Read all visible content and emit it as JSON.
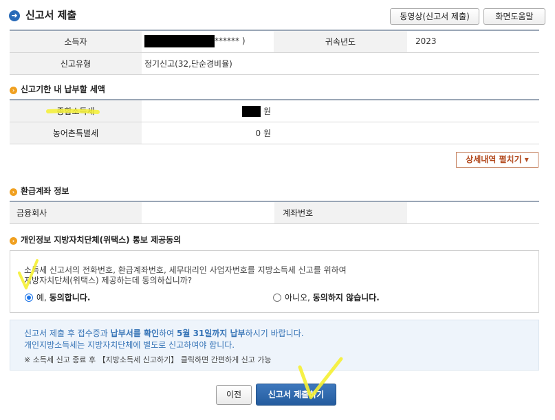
{
  "header": {
    "title": "신고서 제출",
    "video_button": "동영상(신고서 제출)",
    "help_button": "화면도움말"
  },
  "summary": {
    "taxpayer_label": "소득자",
    "taxpayer_value_suffix": "******  )",
    "year_label": "귀속년도",
    "year_value": "2023",
    "report_type_label": "신고유형",
    "report_type_value": "정기신고(32,단순경비율)"
  },
  "tax_section": {
    "title": "신고기한 내 납부할 세액",
    "rows": [
      {
        "label": "종합소득세",
        "amount": "",
        "unit": "원"
      },
      {
        "label": "농어촌특별세",
        "amount": "0",
        "unit": "원"
      }
    ],
    "detail_button": "상세내역 펼치기 ▾"
  },
  "refund_section": {
    "title": "환급계좌 정보",
    "bank_label": "금융회사",
    "bank_value": "",
    "account_label": "계좌번호",
    "account_value": ""
  },
  "consent_section": {
    "title": "개인정보 지방자치단체(위택스) 통보 제공동의",
    "text_line1": "소득세 신고서의 전화번호, 환급계좌번호, 세무대리인 사업자번호를 지방소득세 신고를 위하여",
    "text_line2": "지방자치단체(위택스) 제공하는데 동의하십니까?",
    "option_yes_prefix": "예, ",
    "option_yes_bold": "동의합니다.",
    "option_no_prefix": "아니오, ",
    "option_no_bold": "동의하지 않습니다.",
    "selected": "yes"
  },
  "notice": {
    "l1_a": "신고서 제출 후 접수증과 ",
    "l1_b": "납부서를 확인",
    "l1_c": "하여 ",
    "l1_d": "5월 31일까지 납부",
    "l1_e": "하시기 바랍니다.",
    "l2": "개인지방소득세는 지방자치단체에 별도로 신고하여야 합니다.",
    "l3": "※ 소득세 신고 종료 후 【지방소득세 신고하기】 클릭하면 간편하게 신고 가능"
  },
  "footer": {
    "prev_button": "이전",
    "submit_button": "신고서 제출하기"
  },
  "colors": {
    "accent_blue": "#2a6bb8",
    "highlight_yellow": "#f5f032",
    "section_dot": "#f0a020"
  }
}
